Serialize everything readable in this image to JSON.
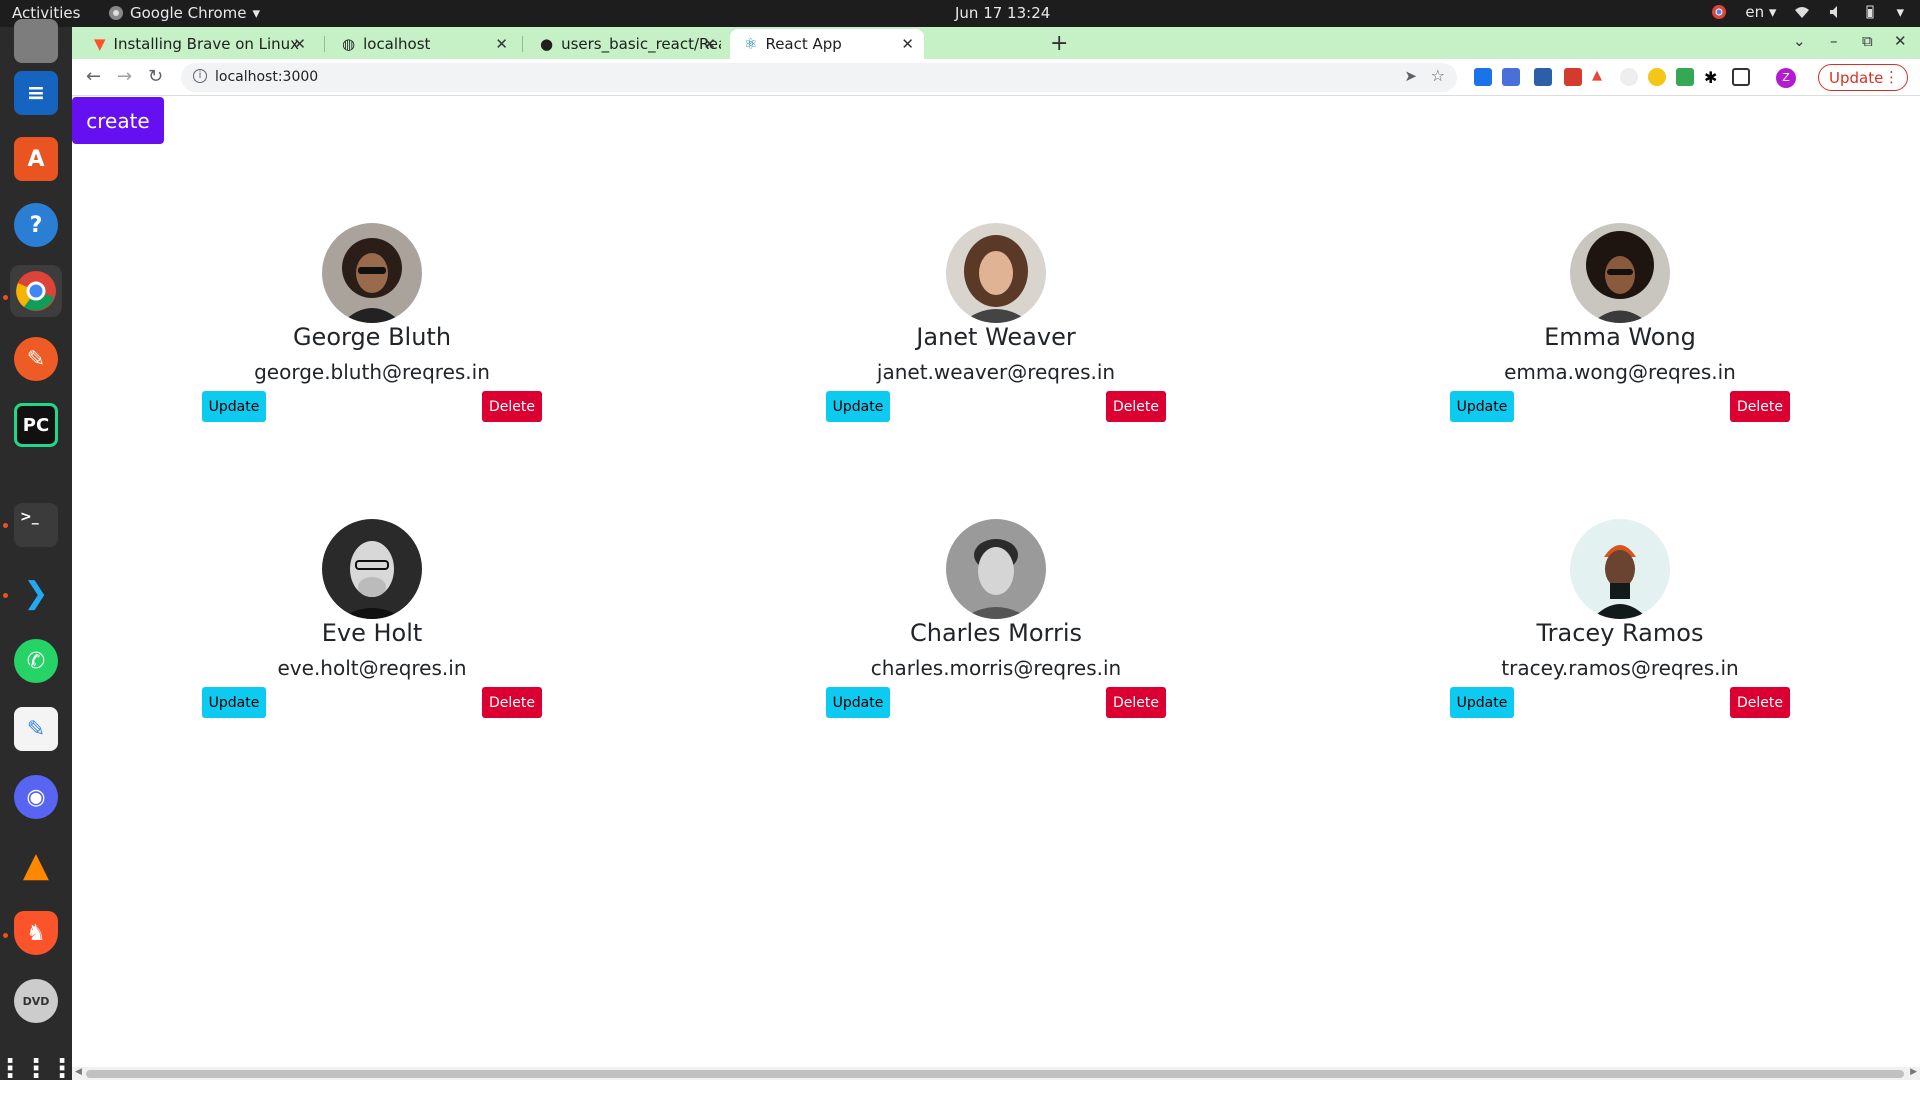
{
  "system": {
    "activities": "Activities",
    "app_name": "Google Chrome",
    "clock": "Jun 17  13:24",
    "keyboard": "en"
  },
  "browser": {
    "tabs": [
      {
        "title": "Installing Brave on Linux",
        "icon": "brave-icon"
      },
      {
        "title": "localhost",
        "icon": "globe-icon"
      },
      {
        "title": "users_basic_react/React.",
        "icon": "github-icon"
      },
      {
        "title": "React App",
        "icon": "react-icon"
      }
    ],
    "url": "localhost:3000",
    "update_label": "Update",
    "profile_initial": "Z"
  },
  "page": {
    "create_label": "create",
    "update_label": "Update",
    "delete_label": "Delete",
    "users": [
      {
        "name": "George Bluth",
        "email": "george.bluth@reqres.in"
      },
      {
        "name": "Janet Weaver",
        "email": "janet.weaver@reqres.in"
      },
      {
        "name": "Emma Wong",
        "email": "emma.wong@reqres.in"
      },
      {
        "name": "Eve Holt",
        "email": "eve.holt@reqres.in"
      },
      {
        "name": "Charles Morris",
        "email": "charles.morris@reqres.in"
      },
      {
        "name": "Tracey Ramos",
        "email": "tracey.ramos@reqres.in"
      }
    ]
  },
  "colors": {
    "create_button": "#6610f2",
    "update_button": "#0dcaf0",
    "delete_button": "#dc0032",
    "tab_bar": "#c6f0c6"
  }
}
